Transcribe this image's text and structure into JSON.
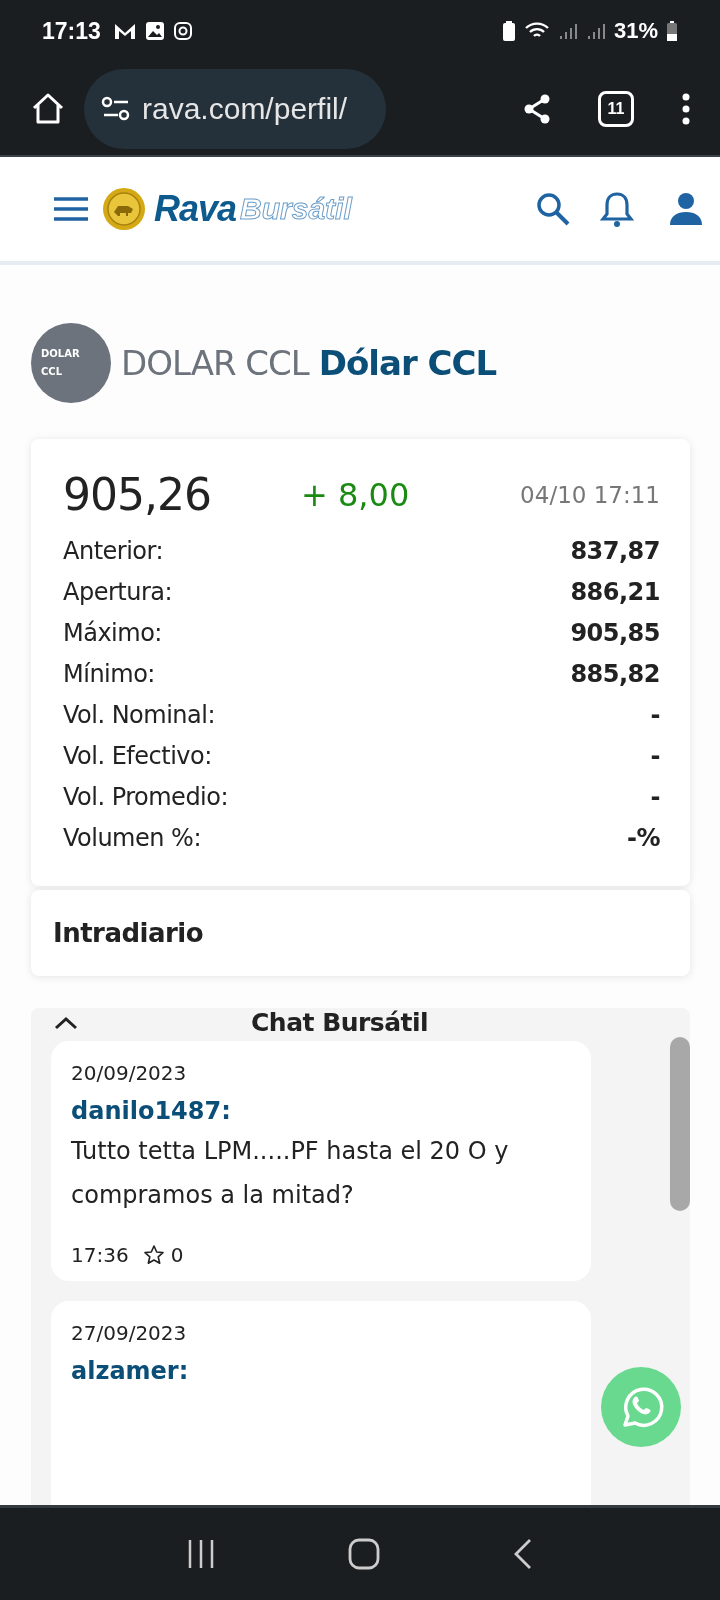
{
  "status_bar": {
    "time": "17:13",
    "battery": "31%"
  },
  "browser": {
    "url": "rava.com/perfil/",
    "tab_count": "11"
  },
  "site_header": {
    "logo_main": "Rava",
    "logo_sub": "Bursátil"
  },
  "instrument": {
    "avatar_text": "DOLAR CCL",
    "symbol": "DOLAR CCL",
    "name": "Dólar CCL"
  },
  "quote": {
    "price": "905,26",
    "change": "+ 8,00",
    "rising": true,
    "datetime": "04/10 17:11",
    "rows": [
      {
        "label": "Anterior:",
        "value": "837,87"
      },
      {
        "label": "Apertura:",
        "value": "886,21"
      },
      {
        "label": "Máximo:",
        "value": "905,85"
      },
      {
        "label": "Mínimo:",
        "value": "885,82"
      },
      {
        "label": "Vol. Nominal:",
        "value": "-"
      },
      {
        "label": "Vol. Efectivo:",
        "value": "-"
      },
      {
        "label": "Vol. Promedio:",
        "value": "-"
      },
      {
        "label": "Volumen %:",
        "value": "-%"
      }
    ]
  },
  "intraday": {
    "title": "Intradiario"
  },
  "chat": {
    "title": "Chat Bursátil",
    "expanded": true,
    "messages": [
      {
        "date": "20/09/2023",
        "user": "danilo1487:",
        "text": "Tutto tetta LPM.....PF hasta el 20 O y compramos a la mitad?",
        "time": "17:36",
        "likes": "0"
      },
      {
        "date": "27/09/2023",
        "user": "alzamer:"
      }
    ]
  }
}
